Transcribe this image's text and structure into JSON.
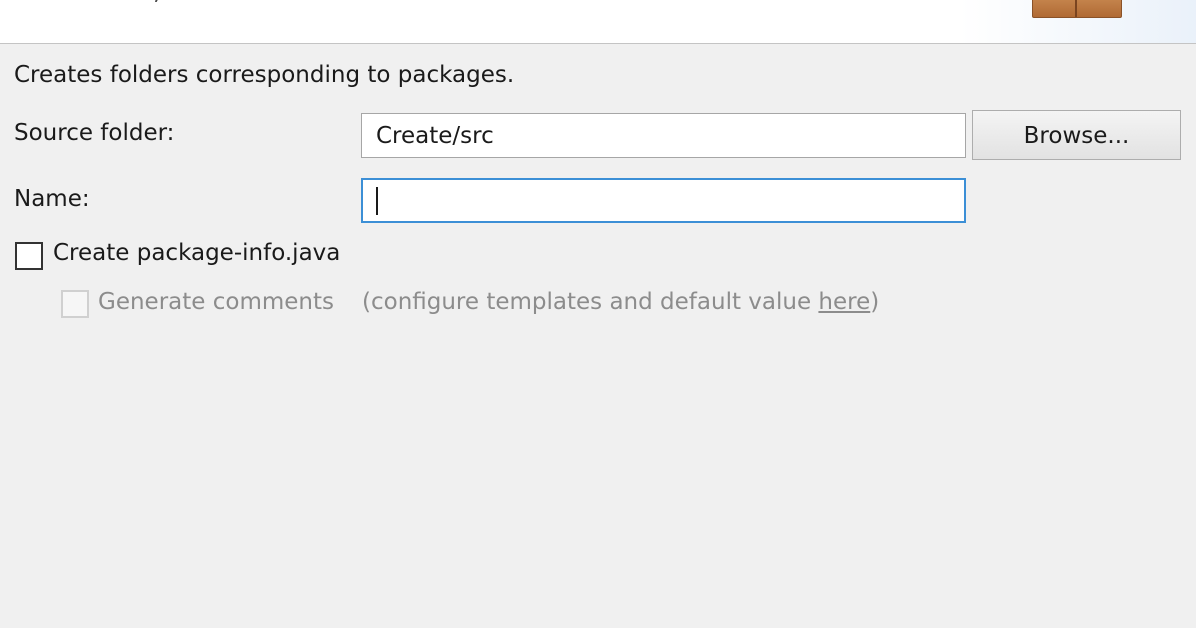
{
  "header": {
    "title_fragment": "· · , · · · · · · ·"
  },
  "page": {
    "description": "Creates folders corresponding to packages."
  },
  "form": {
    "source_folder_label": "Source folder:",
    "source_folder_value": "Create/src",
    "browse_label": "Browse...",
    "name_label": "Name:",
    "name_value": ""
  },
  "options": {
    "create_package_info_label": "Create package-info.java",
    "create_package_info_checked": false,
    "generate_comments_label": "Generate comments",
    "generate_comments_checked": false,
    "generate_comments_enabled": false,
    "configure_prefix": "(configure templates and default value ",
    "configure_link": "here",
    "configure_suffix": ")"
  },
  "colors": {
    "background": "#f0f0f0",
    "focus_border": "#3c8fd6",
    "disabled_text": "#8c8c8c"
  }
}
